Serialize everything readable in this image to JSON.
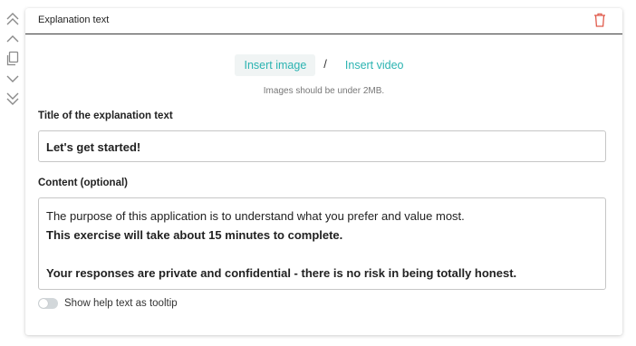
{
  "toolbar": {
    "icons": [
      "double-chevron-up-icon",
      "chevron-up-icon",
      "copy-icon",
      "chevron-down-icon",
      "double-chevron-down-icon"
    ]
  },
  "card": {
    "title": "Explanation text",
    "delete_icon": "trash-icon",
    "delete_color": "#e05a4b"
  },
  "media": {
    "insert_image": "Insert image",
    "separator": "/",
    "insert_video": "Insert video",
    "hint": "Images should be under 2MB.",
    "accent_color": "#2bb3b1"
  },
  "form": {
    "title_label": "Title of the explanation text",
    "title_value": "Let's get started!",
    "content_label": "Content (optional)",
    "content_lines": [
      "The purpose of this application is to understand what you prefer and value most.",
      "This exercise will take about 15 minutes to complete.",
      "",
      "Your responses are private and confidential - there is no risk in being totally honest."
    ],
    "tooltip_toggle_label": "Show help text as tooltip",
    "tooltip_toggle_on": false
  }
}
